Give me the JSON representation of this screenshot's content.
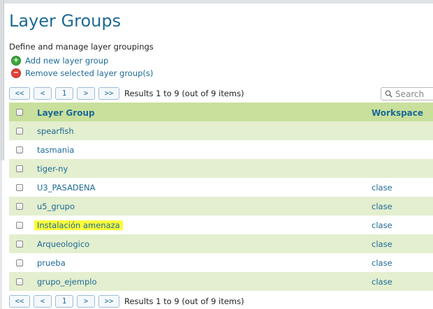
{
  "page": {
    "title": "Layer Groups",
    "description": "Define and manage layer groupings"
  },
  "actions": {
    "add_label": "Add new layer group",
    "remove_label": "Remove selected layer group(s)"
  },
  "pager": {
    "first": "<<",
    "prev": "<",
    "page": "1",
    "next": ">",
    "last": ">>",
    "results": "Results 1 to 9 (out of 9 items)"
  },
  "search": {
    "placeholder": "Search"
  },
  "table": {
    "columns": {
      "name": "Layer Group",
      "workspace": "Workspace"
    },
    "rows": [
      {
        "name": "spearfish",
        "workspace": ""
      },
      {
        "name": "tasmania",
        "workspace": ""
      },
      {
        "name": "tiger-ny",
        "workspace": ""
      },
      {
        "name": "U3_PASADENA",
        "workspace": "clase"
      },
      {
        "name": "u5_grupo",
        "workspace": "clase"
      },
      {
        "name": "Instalación amenaza",
        "workspace": "clase",
        "highlighted": true
      },
      {
        "name": "Arqueologico",
        "workspace": "clase"
      },
      {
        "name": "prueba",
        "workspace": "clase"
      },
      {
        "name": "grupo_ejemplo",
        "workspace": "clase"
      }
    ]
  },
  "colors": {
    "accent": "#1d6a96",
    "header_bg": "#c8e09b",
    "row_alt_bg": "#e3efcf",
    "highlight": "#fbfb3a"
  },
  "icons": {
    "add": "plus-circle-icon",
    "remove": "minus-circle-icon",
    "search": "magnifier-icon"
  }
}
